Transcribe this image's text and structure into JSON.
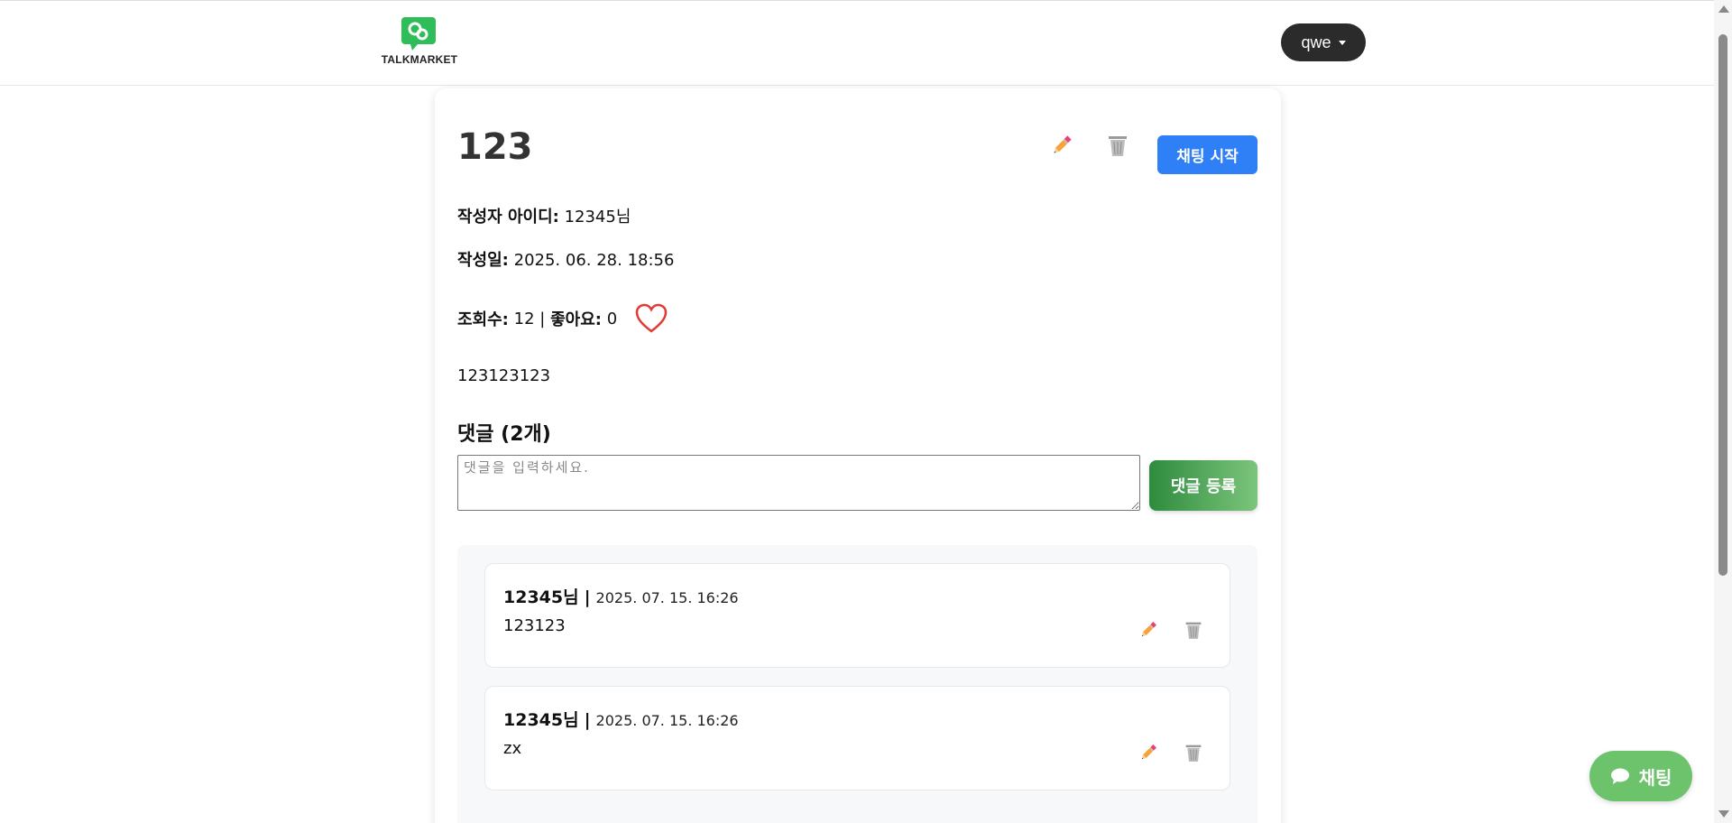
{
  "header": {
    "logo_text": "TALKMARKET",
    "user_name": "qwe"
  },
  "post": {
    "title": "123",
    "chat_start_label": "채팅 시작",
    "author_label": "작성자 아이디:",
    "author_value": "12345님",
    "date_label": "작성일:",
    "date_value": "2025. 06. 28. 18:56",
    "views_label": "조회수:",
    "views_value": "12",
    "stats_separator": "|",
    "likes_label": "좋아요:",
    "likes_value": "0",
    "content": "123123123"
  },
  "comments": {
    "title": "댓글 (2개)",
    "input_placeholder": "댓글을 입력하세요.",
    "submit_label": "댓글 등록",
    "items": [
      {
        "author": "12345님",
        "separator": "|",
        "date": "2025. 07. 15. 16:26",
        "text": "123123"
      },
      {
        "author": "12345님",
        "separator": "|",
        "date": "2025. 07. 15. 16:26",
        "text": "zx"
      }
    ]
  },
  "floating_chat": {
    "label": "채팅",
    "icon": "chat-bubble-icon"
  },
  "icons": {
    "edit": "pencil-icon",
    "delete": "trash-icon",
    "like": "heart-icon",
    "user_menu": "caret-down-icon"
  },
  "colors": {
    "primary_blue": "#2f7ff6",
    "brand_green": "#2ebd59",
    "heart_red": "#e53935",
    "user_pill": "#2b2b2b"
  }
}
